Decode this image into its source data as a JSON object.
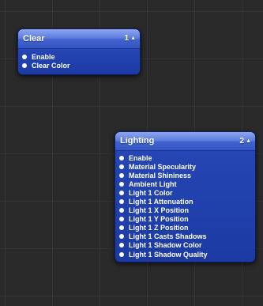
{
  "patches": {
    "clear": {
      "title": "Clear",
      "layer": "1",
      "stepper_icon": "up-down-arrows-icon",
      "ports": [
        {
          "label": "Enable"
        },
        {
          "label": "Clear Color"
        }
      ]
    },
    "lighting": {
      "title": "Lighting",
      "layer": "2",
      "stepper_icon": "up-down-arrows-icon",
      "ports": [
        {
          "label": "Enable"
        },
        {
          "label": "Material Specularity"
        },
        {
          "label": "Material Shininess"
        },
        {
          "label": "Ambient Light"
        },
        {
          "label": "Light 1 Color"
        },
        {
          "label": "Light 1 Attenuation"
        },
        {
          "label": "Light 1 X Position"
        },
        {
          "label": "Light 1 Y Position"
        },
        {
          "label": "Light 1 Z Position"
        },
        {
          "label": "Light 1 Casts Shadows"
        },
        {
          "label": "Light 1 Shadow Color"
        },
        {
          "label": "Light 1 Shadow Quality"
        }
      ]
    }
  },
  "colors": {
    "background": "#2a2a2a",
    "patch_body": "#1f3fa8",
    "title_bar": "#5f7fdf",
    "text": "#ffffff"
  }
}
